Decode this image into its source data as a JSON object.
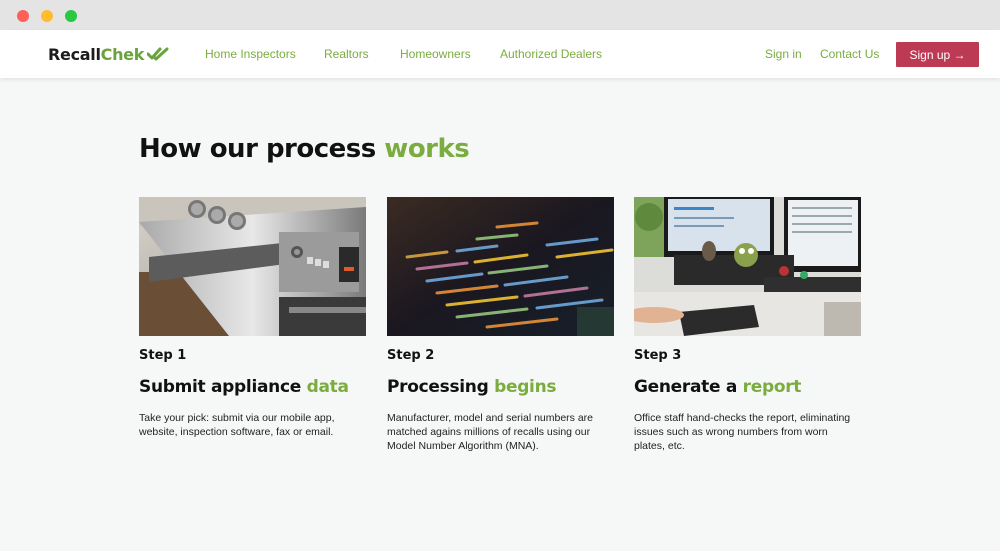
{
  "window": {
    "controls": [
      "close",
      "minimize",
      "maximize"
    ]
  },
  "nav": {
    "logo": {
      "part1": "Recall",
      "part2": "Chek",
      "icon": "double-check-icon"
    },
    "links": [
      "Home Inspectors",
      "Realtors",
      "Homeowners",
      "Authorized Dealers"
    ],
    "sign_in": "Sign in",
    "contact": "Contact Us",
    "sign_up": "Sign up →"
  },
  "hero": {
    "title_part1": "How our process ",
    "title_accent": "works"
  },
  "steps": [
    {
      "label": "Step 1",
      "title_part1": "Submit appliance ",
      "title_accent": "data",
      "description": "Take your pick: submit via our mobile app, website, inspection software, fax or email.",
      "image": "oven-appliance-photo"
    },
    {
      "label": "Step 2",
      "title_part1": "Processing ",
      "title_accent": "begins",
      "description": "Manufacturer, model and serial numbers are matched agains millions of recalls using our Model Number Algorithm (MNA).",
      "image": "source-code-screen-photo"
    },
    {
      "label": "Step 3",
      "title_part1": "Generate a ",
      "title_accent": "report",
      "description": "Office staff hand-checks the report, eliminating issues such as wrong numbers from worn plates, etc.",
      "image": "office-desk-monitors-photo"
    }
  ],
  "colors": {
    "accent": "#7bac3f",
    "logo_accent": "#6aa33d",
    "signup_bg": "#bd3a55",
    "page_bg": "#f6f8f7"
  }
}
